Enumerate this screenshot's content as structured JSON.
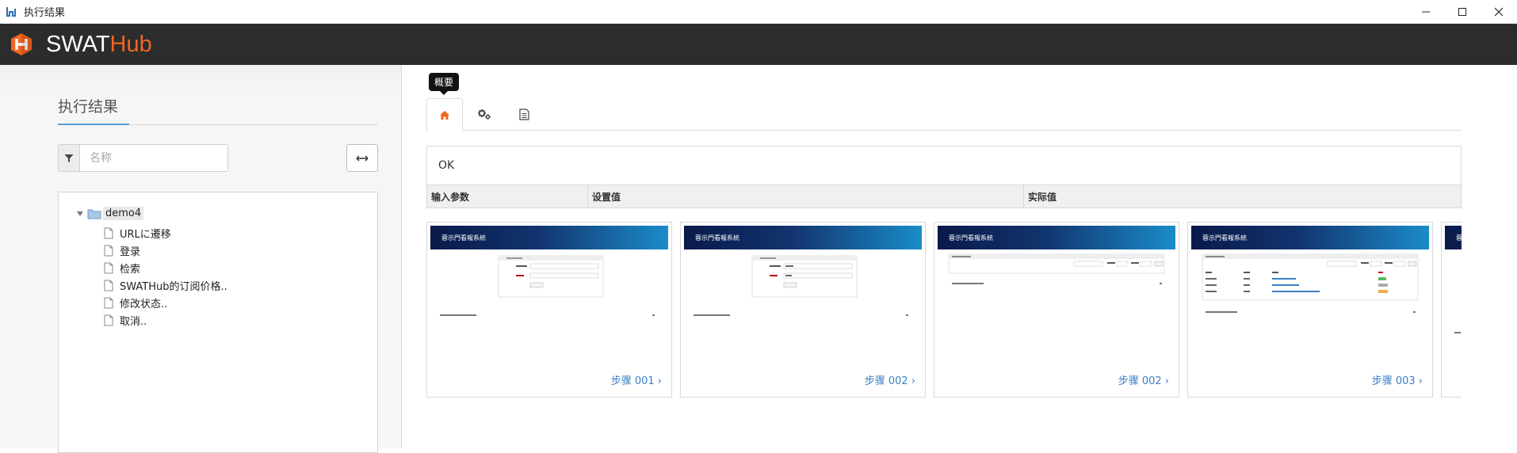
{
  "window": {
    "title": "执行结果",
    "controls": [
      "minimize",
      "maximize",
      "close"
    ]
  },
  "brand": {
    "part1": "SWAT",
    "part2": "Hub",
    "accent": "#f26522"
  },
  "left": {
    "title": "执行结果",
    "filter_placeholder": "名称",
    "tree": {
      "root": "demo4",
      "children": [
        "URLに遷移",
        "登录",
        "检索",
        "SWATHub的订阅价格..",
        "修改状态..",
        "取消.."
      ]
    }
  },
  "right": {
    "tooltip": "概要",
    "tabs": [
      {
        "icon": "home-icon",
        "active": true
      },
      {
        "icon": "gears-icon",
        "active": false
      },
      {
        "icon": "document-icon",
        "active": false
      }
    ],
    "status": "OK",
    "params_headers": [
      "输入参数",
      "设置值",
      "实际值"
    ],
    "screenshots": [
      {
        "header": "蓉示門看報系統",
        "step": "步骤 001 ›"
      },
      {
        "header": "蓉示門看報系統",
        "step": "步骤 002 ›"
      },
      {
        "header": "蓉示門看報系統",
        "step": "步骤 002 ›"
      },
      {
        "header": "蓉示門看報系統",
        "step": "步骤 003 ›"
      },
      {
        "header": "蓉",
        "step": ""
      }
    ]
  }
}
